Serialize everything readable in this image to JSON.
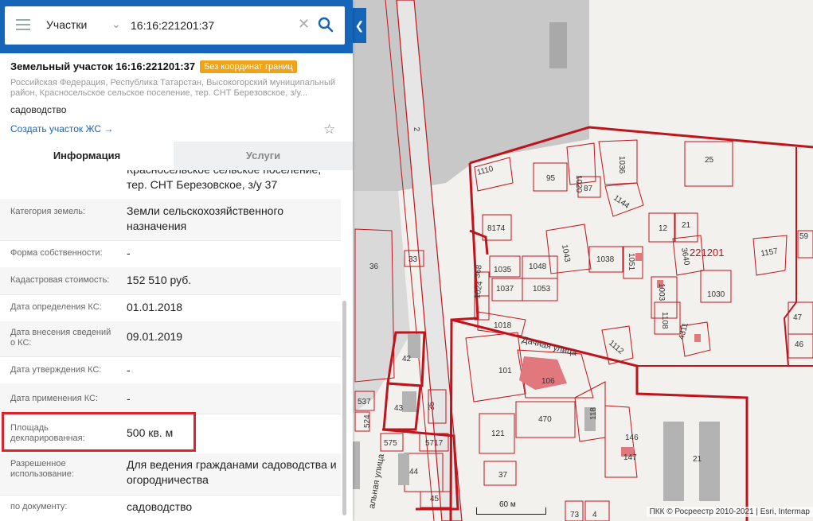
{
  "search": {
    "type_label": "Участки",
    "query": "16:16:221201:37"
  },
  "parcel": {
    "title": "Земельный участок 16:16:221201:37",
    "badge": "Без координат границ",
    "address": "Российская Федерация, Республика Татарстан, Высокогорский муниципальный район, Красносельское сельское поселение, тер. СНТ Березовское, з/у...",
    "purpose": "садоводство",
    "create_link": "Создать участок ЖС →"
  },
  "tabs": [
    {
      "label": "Информация",
      "active": true
    },
    {
      "label": "Услуги",
      "active": false
    }
  ],
  "info": {
    "address_tail": "Красносельское сельское поселение, тер. СНТ Березовское, з/у 37",
    "rows": [
      {
        "key": "Категория земель:",
        "value": "Земли сельскохозяйственного назначения"
      },
      {
        "key": "Форма собственности:",
        "value": "-"
      },
      {
        "key": "Кадастровая стоимость:",
        "value": "152 510 руб."
      },
      {
        "key": "Дата определения КС:",
        "value": "01.01.2018"
      },
      {
        "key": "Дата внесения сведений о КС:",
        "value": "09.01.2019"
      },
      {
        "key": "Дата утверждения КС:",
        "value": "-"
      },
      {
        "key": "Дата применения КС:",
        "value": "-"
      },
      {
        "key": "Площадь декларированная:",
        "value": "500 кв. м"
      },
      {
        "key": "Разрешенное использование:",
        "value": "Для ведения гражданами садоводства и огородничества"
      },
      {
        "key": "по документу:",
        "value": "садоводство"
      }
    ]
  },
  "map": {
    "quarter": "221201",
    "street_dachnaya": "Дачная улица",
    "street_centralnaya": "альная улица",
    "road_number": "2",
    "scale_label": "60 м",
    "attribution": "ПКК © Росреестр 2010-2021 | Esri, Intermap",
    "parcels": [
      "1110",
      "95",
      "1020",
      "87",
      "1036",
      "25",
      "1144",
      "8174",
      "12",
      "21",
      "59",
      "1043",
      "1048",
      "1035",
      "1037",
      "1053",
      "1038",
      "1051",
      "3640",
      "1157",
      "1003",
      "1030",
      "1108",
      "47",
      "1024",
      "368",
      "1018",
      "1112",
      "4311",
      "46",
      "101",
      "106",
      "36",
      "33",
      "42",
      "43",
      "35",
      "537",
      "524",
      "470",
      "118",
      "121",
      "146",
      "147",
      "21",
      "575",
      "5717",
      "44",
      "37",
      "45",
      "73",
      "4"
    ]
  }
}
